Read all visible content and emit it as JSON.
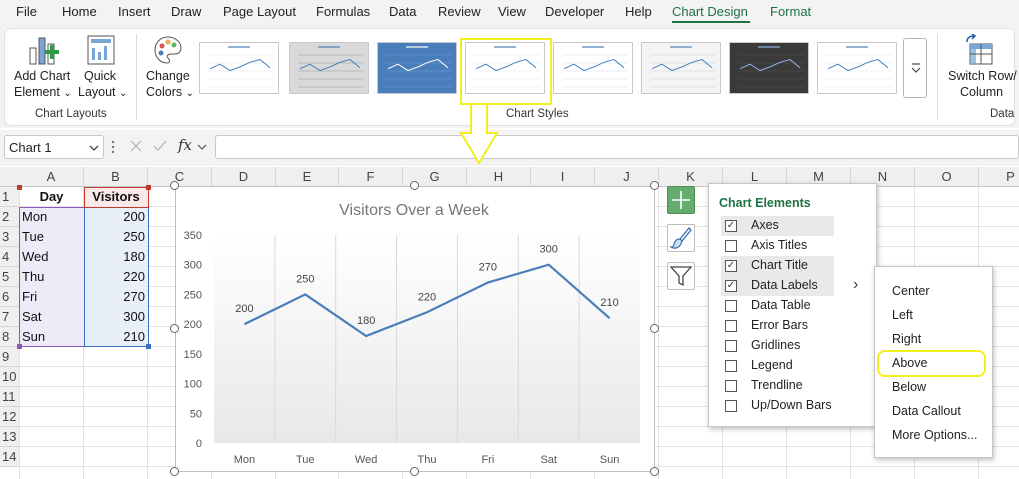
{
  "menu": [
    "File",
    "Home",
    "Insert",
    "Draw",
    "Page Layout",
    "Formulas",
    "Data",
    "Review",
    "View",
    "Developer",
    "Help",
    "Chart Design",
    "Format"
  ],
  "ribbon": {
    "add_chart_element_1": "Add Chart",
    "add_chart_element_2": "Element",
    "quick_layout_1": "Quick",
    "quick_layout_2": "Layout",
    "change_colors_1": "Change",
    "change_colors_2": "Colors",
    "group_chart_layouts": "Chart Layouts",
    "group_chart_styles": "Chart Styles",
    "switch_row_1": "Switch Row/",
    "switch_row_2": "Column",
    "group_data": "Data",
    "dropdown_glyph": "⌄"
  },
  "formula_bar": {
    "name_box": "Chart 1",
    "fx": "fx",
    "formula": ""
  },
  "columns": [
    "A",
    "B",
    "C",
    "D",
    "E",
    "F",
    "G",
    "H",
    "I",
    "J",
    "K",
    "L",
    "M",
    "N",
    "O",
    "P"
  ],
  "rows": [
    "1",
    "2",
    "3",
    "4",
    "5",
    "6",
    "7",
    "8",
    "9",
    "10",
    "11",
    "12",
    "13",
    "14"
  ],
  "table": {
    "header": [
      "Day",
      "Visitors"
    ],
    "rows": [
      [
        "Mon",
        "200"
      ],
      [
        "Tue",
        "250"
      ],
      [
        "Wed",
        "180"
      ],
      [
        "Thu",
        "220"
      ],
      [
        "Fri",
        "270"
      ],
      [
        "Sat",
        "300"
      ],
      [
        "Sun",
        "210"
      ]
    ]
  },
  "chart_data": {
    "type": "line",
    "title": "Visitors Over a Week",
    "categories": [
      "Mon",
      "Tue",
      "Wed",
      "Thu",
      "Fri",
      "Sat",
      "Sun"
    ],
    "series": [
      {
        "values": [
          200,
          250,
          180,
          220,
          270,
          300,
          210
        ]
      }
    ],
    "ylim": [
      0,
      350
    ],
    "yticks": [
      0,
      50,
      100,
      150,
      200,
      250,
      300,
      350
    ],
    "data_labels": [
      "200",
      "250",
      "180",
      "220",
      "270",
      "300",
      "210"
    ],
    "grid": "vertical",
    "line_color": "#4a7ebb"
  },
  "chart_elements": {
    "title": "Chart Elements",
    "items": [
      {
        "label": "Axes",
        "checked": true
      },
      {
        "label": "Axis Titles",
        "checked": false
      },
      {
        "label": "Chart Title",
        "checked": true
      },
      {
        "label": "Data Labels",
        "checked": true
      },
      {
        "label": "Data Table",
        "checked": false
      },
      {
        "label": "Error Bars",
        "checked": false
      },
      {
        "label": "Gridlines",
        "checked": false
      },
      {
        "label": "Legend",
        "checked": false
      },
      {
        "label": "Trendline",
        "checked": false
      },
      {
        "label": "Up/Down Bars",
        "checked": false
      }
    ],
    "submenu_arrow": "›"
  },
  "data_labels_submenu": [
    "Center",
    "Left",
    "Right",
    "Above",
    "Below",
    "Data Callout",
    "More Options..."
  ],
  "colors": {
    "accent_green": "#1f7244",
    "highlight_yellow": "#f5ee1e",
    "line_blue": "#4a7ebb"
  },
  "icons": [
    "add-chart-element-icon",
    "quick-layout-icon",
    "change-colors-icon",
    "switch-row-column-icon",
    "chart-elements-plus-icon",
    "chart-styles-brush-icon",
    "chart-filters-funnel-icon",
    "checkmark-icon",
    "cancel-x-icon",
    "fx-icon",
    "chevron-down-icon",
    "arrow-down-annotation-icon"
  ]
}
